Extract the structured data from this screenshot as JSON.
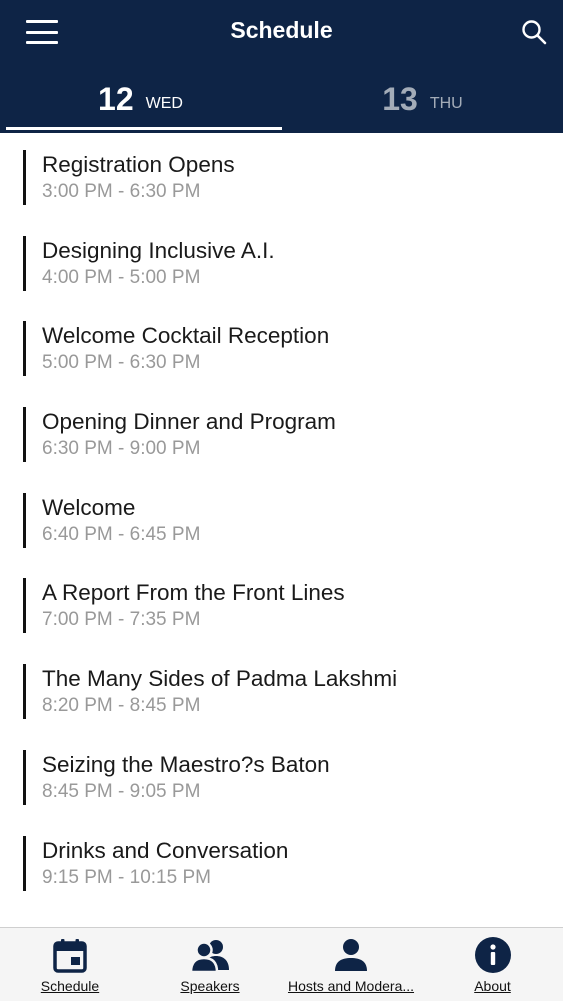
{
  "header": {
    "title": "Schedule",
    "background": "#0e2446"
  },
  "date_tabs": [
    {
      "day": "12",
      "weekday": "WED",
      "selected": true
    },
    {
      "day": "13",
      "weekday": "THU",
      "selected": false
    }
  ],
  "sessions": [
    {
      "title": "Registration Opens",
      "time": "3:00 PM - 6:30 PM"
    },
    {
      "title": "Designing Inclusive A.I.",
      "time": "4:00 PM - 5:00 PM"
    },
    {
      "title": "Welcome Cocktail Reception",
      "time": "5:00 PM - 6:30 PM"
    },
    {
      "title": "Opening Dinner and Program",
      "time": "6:30 PM - 9:00 PM"
    },
    {
      "title": "Welcome",
      "time": "6:40 PM - 6:45 PM"
    },
    {
      "title": "A Report From the Front Lines",
      "time": "7:00 PM - 7:35 PM"
    },
    {
      "title": "The Many Sides of Padma Lakshmi",
      "time": "8:20 PM - 8:45 PM"
    },
    {
      "title": "Seizing the Maestro?s Baton",
      "time": "8:45 PM - 9:05 PM"
    },
    {
      "title": "Drinks and Conversation",
      "time": "9:15 PM - 10:15 PM"
    }
  ],
  "bottom_nav": [
    {
      "label": "Schedule",
      "icon": "calendar-icon"
    },
    {
      "label": "Speakers",
      "icon": "speakers-icon"
    },
    {
      "label": "Hosts and Modera...",
      "icon": "person-icon"
    },
    {
      "label": "About",
      "icon": "info-icon"
    }
  ]
}
